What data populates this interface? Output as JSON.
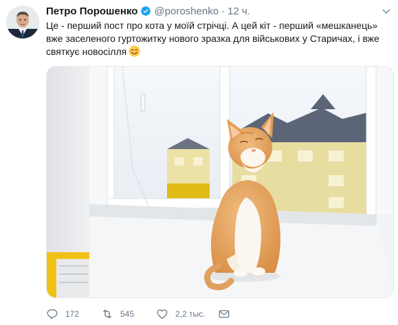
{
  "tweet": {
    "author_name": "Петро Порошенко",
    "handle": "@poroshenko",
    "separator": "·",
    "time": "12 ч.",
    "text": "Це - перший пост про кота у моїй стрічці. А цей кіт - перший «мешканець» вже заселеного гуртожитку нового зразка для військових у Старичах, і вже святкує новосілля"
  },
  "actions": {
    "replies": "172",
    "retweets": "545",
    "likes": "2,2 тыс."
  },
  "colors": {
    "verified": "#1da1f2",
    "secondary_text": "#657786",
    "primary_text": "#14171a"
  }
}
